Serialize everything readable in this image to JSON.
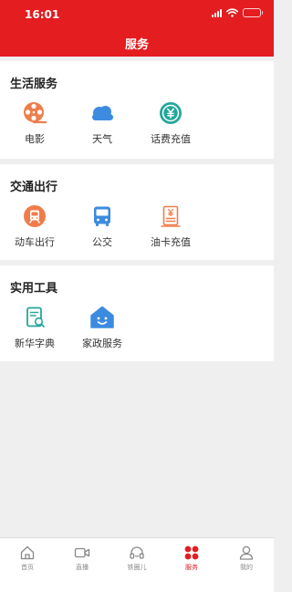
{
  "status_bar": {
    "time": "16:01",
    "battery_level": 0.35,
    "icons": [
      "signal-icon",
      "wifi-icon",
      "battery-icon"
    ]
  },
  "nav": {
    "title": "服务"
  },
  "colors": {
    "brand": "#e41d20",
    "orange": "#ef7d4b",
    "blue": "#3d8be0",
    "teal": "#23a79a"
  },
  "sections": [
    {
      "title": "生活服务",
      "items": [
        {
          "label": "电影",
          "icon": "film-reel-icon"
        },
        {
          "label": "天气",
          "icon": "cloud-icon"
        },
        {
          "label": "话费充值",
          "icon": "yuan-coin-icon"
        }
      ]
    },
    {
      "title": "交通出行",
      "items": [
        {
          "label": "动车出行",
          "icon": "train-icon"
        },
        {
          "label": "公交",
          "icon": "bus-icon"
        },
        {
          "label": "油卡充值",
          "icon": "fuel-card-icon"
        }
      ]
    },
    {
      "title": "实用工具",
      "items": [
        {
          "label": "新华字典",
          "icon": "dictionary-icon"
        },
        {
          "label": "家政服务",
          "icon": "house-smile-icon"
        }
      ]
    }
  ],
  "tabbar": {
    "active": 3,
    "tabs": [
      {
        "label": "首页",
        "icon": "home-icon"
      },
      {
        "label": "直播",
        "icon": "video-camera-icon"
      },
      {
        "label": "铁圈儿",
        "icon": "headset-icon"
      },
      {
        "label": "服务",
        "icon": "services-dots-icon"
      },
      {
        "label": "我的",
        "icon": "user-icon"
      }
    ]
  }
}
